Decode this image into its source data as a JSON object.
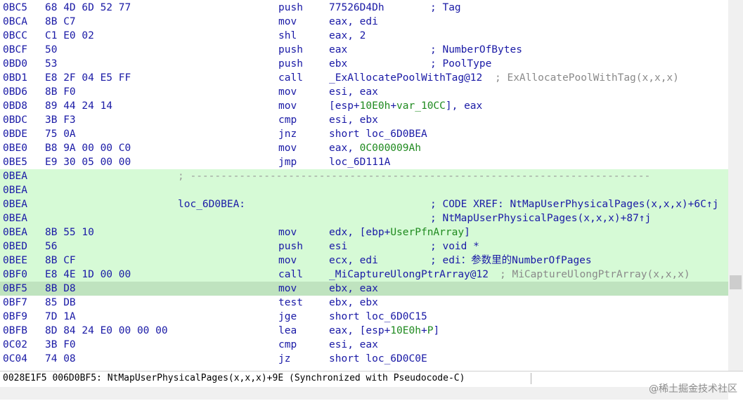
{
  "rows": [
    {
      "addr": "0BC5",
      "bytes": "68 4D 6D 52 77",
      "mn": "push",
      "op": [
        [
          "t",
          "77526D4Dh"
        ]
      ],
      "cmt": "; Tag",
      "cmtLeft": 612,
      "hl": false,
      "cur": false
    },
    {
      "addr": "0BCA",
      "bytes": "8B C7",
      "mn": "mov",
      "op": [
        [
          "t",
          "eax, edi"
        ]
      ],
      "hl": false,
      "cur": false
    },
    {
      "addr": "0BCC",
      "bytes": "C1 E0 02",
      "mn": "shl",
      "op": [
        [
          "t",
          "eax, 2"
        ]
      ],
      "hl": false,
      "cur": false
    },
    {
      "addr": "0BCF",
      "bytes": "50",
      "mn": "push",
      "op": [
        [
          "t",
          "eax"
        ]
      ],
      "cmt": "; NumberOfBytes",
      "cmtLeft": 612,
      "hl": false,
      "cur": false
    },
    {
      "addr": "0BD0",
      "bytes": "53",
      "mn": "push",
      "op": [
        [
          "t",
          "ebx"
        ]
      ],
      "cmt": "; PoolType",
      "cmtLeft": 612,
      "hl": false,
      "cur": false
    },
    {
      "addr": "0BD1",
      "bytes": "E8 2F 04 E5 FF",
      "mn": "call",
      "op": [
        [
          "t",
          "_ExAllocatePoolWithTag@12"
        ]
      ],
      "cmtg": "; ExAllocatePoolWithTag(x,x,x)",
      "cmtLeft": 704,
      "hl": false,
      "cur": false
    },
    {
      "addr": "0BD6",
      "bytes": "8B F0",
      "mn": "mov",
      "op": [
        [
          "t",
          "esi, eax"
        ]
      ],
      "hl": false,
      "cur": false
    },
    {
      "addr": "0BD8",
      "bytes": "89 44 24 14",
      "mn": "mov",
      "op": [
        [
          "t",
          "[esp+"
        ],
        [
          "n",
          "10E0h"
        ],
        [
          "t",
          "+"
        ],
        [
          "s",
          "var_10CC"
        ],
        [
          "t",
          "], eax"
        ]
      ],
      "hl": false,
      "cur": false
    },
    {
      "addr": "0BDC",
      "bytes": "3B F3",
      "mn": "cmp",
      "op": [
        [
          "t",
          "esi, ebx"
        ]
      ],
      "hl": false,
      "cur": false
    },
    {
      "addr": "0BDE",
      "bytes": "75 0A",
      "mn": "jnz",
      "op": [
        [
          "t",
          "short loc_6D0BEA"
        ]
      ],
      "hl": false,
      "cur": false
    },
    {
      "addr": "0BE0",
      "bytes": "B8 9A 00 00 C0",
      "mn": "mov",
      "op": [
        [
          "t",
          "eax, "
        ],
        [
          "n",
          "0C000009Ah"
        ]
      ],
      "hl": false,
      "cur": false
    },
    {
      "addr": "0BE5",
      "bytes": "E9 30 05 00 00",
      "mn": "jmp",
      "op": [
        [
          "t",
          "loc_6D111A"
        ]
      ],
      "hl": false,
      "cur": false
    },
    {
      "addr": "0BEA",
      "sep": "; ---------------------------------------------------------------------------",
      "hl": true,
      "cur": false
    },
    {
      "addr": "0BEA",
      "hl": true,
      "cur": false
    },
    {
      "addr": "0BEA",
      "lbl": "loc_6D0BEA:",
      "cmt": "; CODE XREF: NtMapUserPhysicalPages(x,x,x)+6C↑j",
      "cmtLeft": 612,
      "hl": true,
      "cur": false
    },
    {
      "addr": "0BEA",
      "cmt": "; NtMapUserPhysicalPages(x,x,x)+87↑j",
      "cmtLeft": 612,
      "hl": true,
      "cur": false
    },
    {
      "addr": "0BEA",
      "bytes": "8B 55 10",
      "mn": "mov",
      "op": [
        [
          "t",
          "edx, [ebp+"
        ],
        [
          "s",
          "UserPfnArray"
        ],
        [
          "t",
          "]"
        ]
      ],
      "hl": true,
      "cur": false
    },
    {
      "addr": "0BED",
      "bytes": "56",
      "mn": "push",
      "op": [
        [
          "t",
          "esi"
        ]
      ],
      "cmt": "; void *",
      "cmtLeft": 612,
      "hl": true,
      "cur": false
    },
    {
      "addr": "0BEE",
      "bytes": "8B CF",
      "mn": "mov",
      "op": [
        [
          "t",
          "ecx, edi"
        ]
      ],
      "cmt": "; edi：参数里的NumberOfPages",
      "cmtLeft": 612,
      "hl": true,
      "cur": false
    },
    {
      "addr": "0BF0",
      "bytes": "E8 4E 1D 00 00",
      "mn": "call",
      "op": [
        [
          "t",
          "_MiCaptureUlongPtrArray@12"
        ]
      ],
      "cmtg": "; MiCaptureUlongPtrArray(x,x,x)",
      "cmtLeft": 711,
      "hl": true,
      "cur": false
    },
    {
      "addr": "0BF5",
      "bytes": "8B D8",
      "mn": "mov",
      "op": [
        [
          "t",
          "ebx, eax"
        ]
      ],
      "hl": false,
      "cur": true
    },
    {
      "addr": "0BF7",
      "bytes": "85 DB",
      "mn": "test",
      "op": [
        [
          "t",
          "ebx, ebx"
        ]
      ],
      "hl": false,
      "cur": false
    },
    {
      "addr": "0BF9",
      "bytes": "7D 1A",
      "mn": "jge",
      "op": [
        [
          "t",
          "short loc_6D0C15"
        ]
      ],
      "hl": false,
      "cur": false
    },
    {
      "addr": "0BFB",
      "bytes": "8D 84 24 E0 00 00 00",
      "mn": "lea",
      "op": [
        [
          "t",
          "eax, [esp+"
        ],
        [
          "n",
          "10E0h"
        ],
        [
          "t",
          "+"
        ],
        [
          "s",
          "P"
        ],
        [
          "t",
          "]"
        ]
      ],
      "hl": false,
      "cur": false
    },
    {
      "addr": "0C02",
      "bytes": "3B F0",
      "mn": "cmp",
      "op": [
        [
          "t",
          "esi, eax"
        ]
      ],
      "hl": false,
      "cur": false
    },
    {
      "addr": "0C04",
      "bytes": "74 08",
      "mn": "jz",
      "op": [
        [
          "t",
          "short loc_6D0C0E"
        ]
      ],
      "hl": false,
      "cur": false
    }
  ],
  "status": {
    "text": "0028E1F5 006D0BF5: NtMapUserPhysicalPages(x,x,x)+9E (Synchronized with Pseudocode-C)"
  },
  "watermark": "@稀土掘金技术社区",
  "colors": {
    "highlight": "#d6fad6",
    "current": "#bfe3bf",
    "text": "#1a1aa6",
    "number": "#1f8a1f",
    "comment_gray": "#8a8a8a"
  }
}
